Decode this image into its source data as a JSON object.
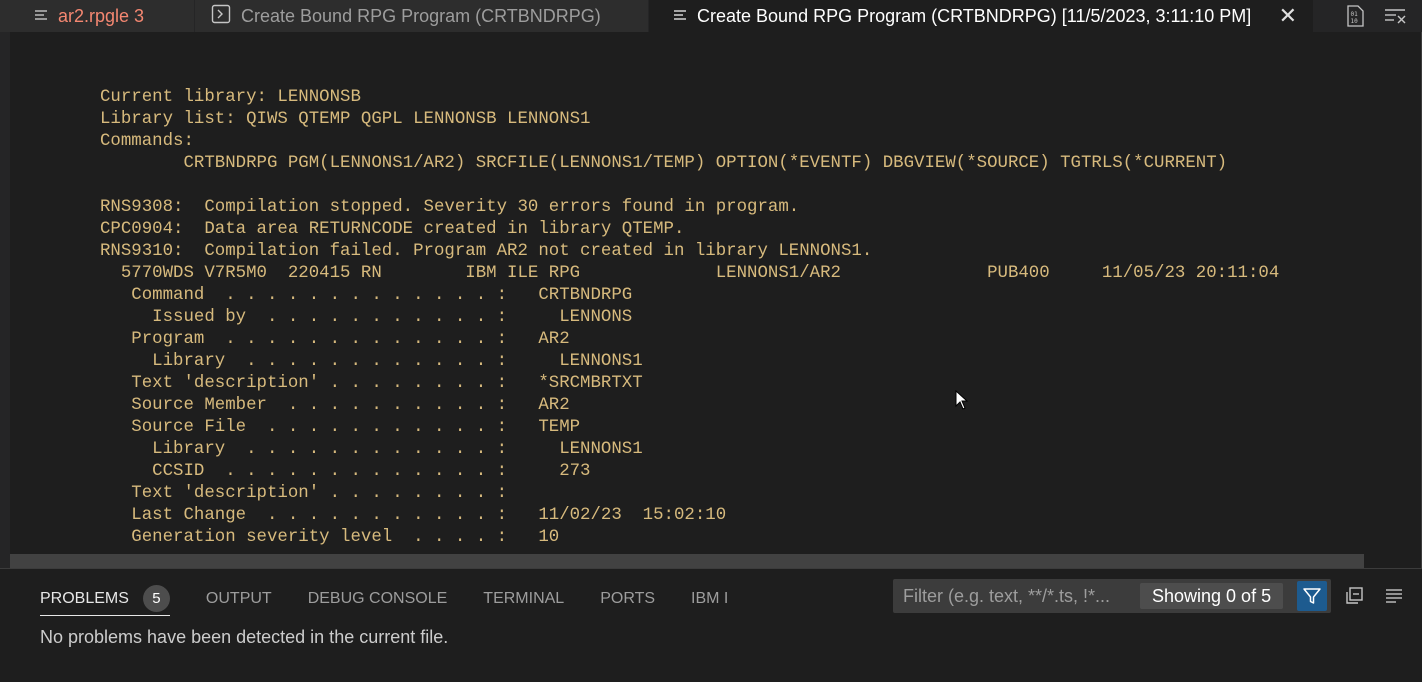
{
  "tabs": [
    {
      "label": "ar2.rpgle 3",
      "icon": "menu-lines-icon"
    },
    {
      "label": "Create Bound RPG Program (CRTBNDRPG)",
      "icon": "terminal-icon"
    },
    {
      "label": "Create Bound RPG Program (CRTBNDRPG) [11/5/2023, 3:11:10 PM]",
      "icon": "menu-lines-icon"
    }
  ],
  "tab_actions": [
    "binary-view-icon",
    "clear-output-icon"
  ],
  "output_lines": [
    "Current library: LENNONSB",
    "Library list: QIWS QTEMP QGPL LENNONSB LENNONS1",
    "Commands:",
    "        CRTBNDRPG PGM(LENNONS1/AR2) SRCFILE(LENNONS1/TEMP) OPTION(*EVENTF) DBGVIEW(*SOURCE) TGTRLS(*CURRENT)",
    "",
    "RNS9308:  Compilation stopped. Severity 30 errors found in program.",
    "CPC0904:  Data area RETURNCODE created in library QTEMP.",
    "RNS9310:  Compilation failed. Program AR2 not created in library LENNONS1.",
    "  5770WDS V7R5M0  220415 RN        IBM ILE RPG             LENNONS1/AR2              PUB400     11/05/23 20:11:04",
    "   Command  . . . . . . . . . . . . . :   CRTBNDRPG",
    "     Issued by  . . . . . . . . . . . :     LENNONS",
    "   Program  . . . . . . . . . . . . . :   AR2",
    "     Library  . . . . . . . . . . . . :     LENNONS1",
    "   Text 'description' . . . . . . . . :   *SRCMBRTXT",
    "   Source Member  . . . . . . . . . . :   AR2",
    "   Source File  . . . . . . . . . . . :   TEMP",
    "     Library  . . . . . . . . . . . . :     LENNONS1",
    "     CCSID  . . . . . . . . . . . . . :     273",
    "   Text 'description' . . . . . . . . :",
    "   Last Change  . . . . . . . . . . . :   11/02/23  15:02:10",
    "   Generation severity level  . . . . :   10"
  ],
  "panel": {
    "tabs": [
      "PROBLEMS",
      "OUTPUT",
      "DEBUG CONSOLE",
      "TERMINAL",
      "PORTS",
      "IBM I"
    ],
    "problems_count": "5",
    "filter_placeholder": "Filter (e.g. text, **/*.ts, !*...",
    "showing": "Showing 0 of 5",
    "message": "No problems have been detected in the current file.",
    "icons": [
      "filter-icon",
      "collapse-all-icon",
      "view-as-list-icon"
    ]
  },
  "colors": {
    "output_text": "#d7ba7d",
    "error_tab": "#f48771",
    "filter_active": "#1d5b8f"
  }
}
